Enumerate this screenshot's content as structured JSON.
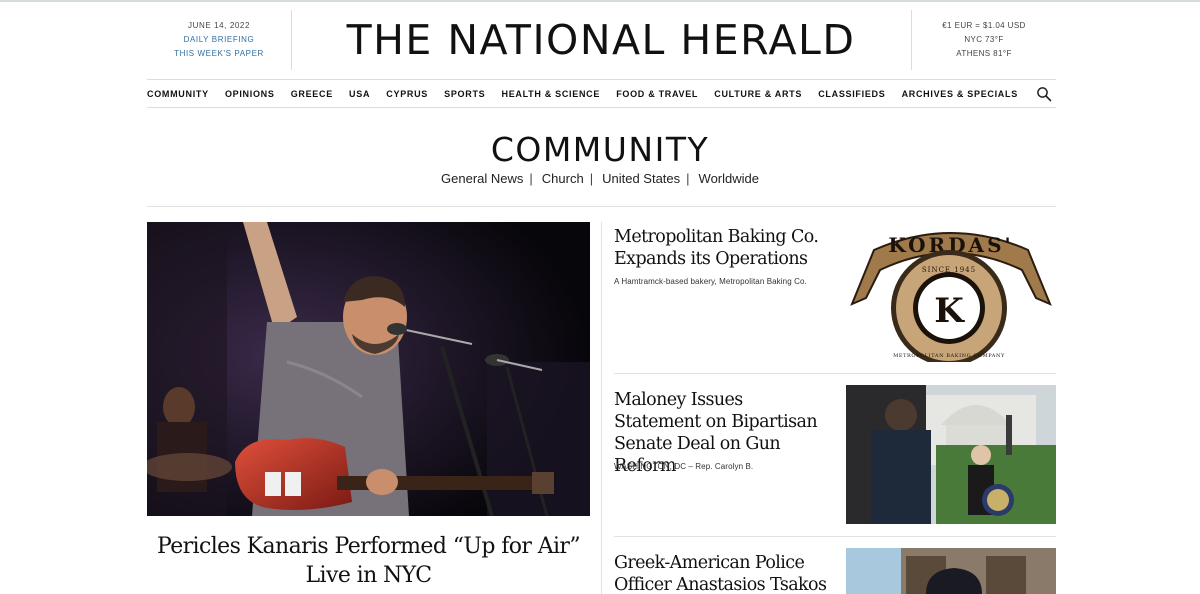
{
  "masthead": {
    "date": "JUNE 14, 2022",
    "daily_briefing": "DAILY BRIEFING",
    "this_weeks_paper": "THIS WEEK'S PAPER",
    "title": "THE NATIONAL HERALD",
    "exchange_rate": "€1 EUR = $1.04 USD",
    "weather_nyc": "NYC 73°F",
    "weather_athens": "ATHENS 81°F"
  },
  "nav": {
    "items": [
      "COMMUNITY",
      "OPINIONS",
      "GREECE",
      "USA",
      "CYPRUS",
      "SPORTS",
      "HEALTH & SCIENCE",
      "FOOD & TRAVEL",
      "CULTURE & ARTS",
      "CLASSIFIEDS",
      "ARCHIVES & SPECIALS"
    ],
    "search_icon": "search-icon"
  },
  "section": {
    "title": "COMMUNITY",
    "subnav": [
      "General News",
      "Church",
      "United States",
      "Worldwide"
    ],
    "separator": "|"
  },
  "main_story": {
    "headline": "Pericles Kanaris Performed “Up for Air” Live in NYC"
  },
  "side_stories": [
    {
      "headline": "Metropolitan Baking Co. Expands its Operations",
      "excerpt": "A Hamtramck-based bakery, Metropolitan Baking Co.",
      "logo": {
        "brand": "KORDAS'",
        "since": "SINCE 1945",
        "letter": "K",
        "company": "METROPOLITAN BAKING COMPANY"
      }
    },
    {
      "headline": "Maloney Issues Statement on Bipartisan Senate Deal on Gun Reform",
      "excerpt": "WASHINGTON, DC – Rep. Carolyn B."
    },
    {
      "headline": "Greek-American Police Officer Anastasios Tsakos",
      "excerpt": ""
    }
  ],
  "colors": {
    "link_blue": "#2f6fa3",
    "logo_brown": "#a07a4a",
    "text": "#111111",
    "rule": "#dcdcdc"
  }
}
